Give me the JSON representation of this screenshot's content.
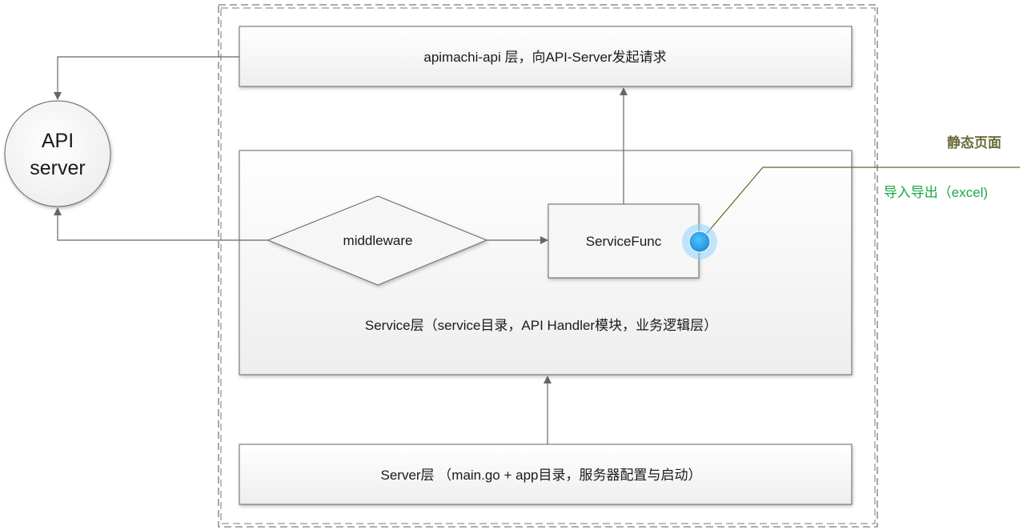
{
  "layers": {
    "api_client": "apimachi-api 层，向API-Server发起请求",
    "service": "Service层（service目录，API Handler模块，业务逻辑层）",
    "server": "Server层 （main.go + app目录，服务器配置与启动）"
  },
  "nodes": {
    "api_server_line1": "API",
    "api_server_line2": "server",
    "middleware": "middleware",
    "service_func": "ServiceFunc"
  },
  "annotation": {
    "title": "静态页面",
    "item": "导入导出（excel)"
  },
  "colors": {
    "middleware_text": "#e60000",
    "annotation_title": "#6b6b3a",
    "annotation_item": "#19a84a",
    "annotation_line": "#5a6b2a",
    "marker_fill": "#29a3e8",
    "box_fill": "#f4f4f4",
    "box_stroke": "#666666",
    "arrow": "#666666"
  }
}
